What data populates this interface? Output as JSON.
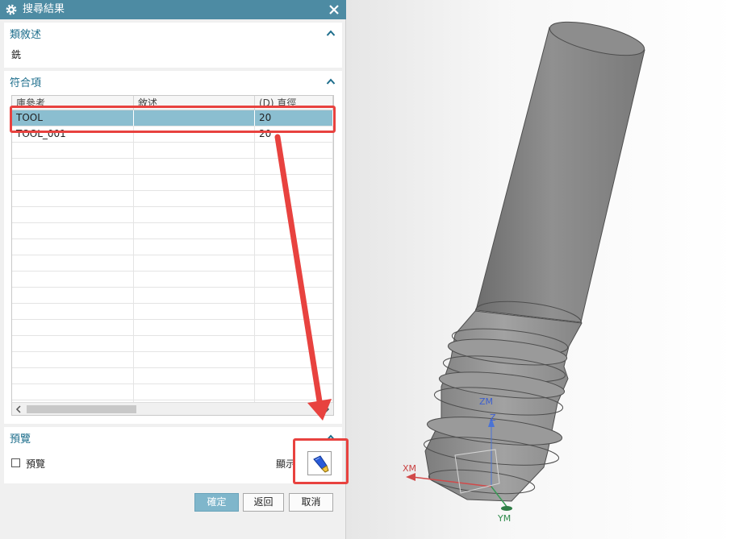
{
  "dialog": {
    "title": "搜尋結果",
    "icons": {
      "title": "gear-icon",
      "close": "close-icon"
    }
  },
  "description_section": {
    "title": "類敘述",
    "value": "銑"
  },
  "matches_section": {
    "title": "符合項",
    "columns": [
      "庫參考",
      "敘述",
      "(D) 直徑"
    ],
    "rows": [
      {
        "ref": "TOOL",
        "desc": "",
        "diameter": "20",
        "selected": true
      },
      {
        "ref": "TOOL_001",
        "desc": "",
        "diameter": "20",
        "selected": false
      }
    ],
    "empty_row_count": 17
  },
  "preview_section": {
    "title": "預覽",
    "checkbox_label": "預覽",
    "checkbox_checked": false,
    "show_label": "顯示"
  },
  "buttons": {
    "ok": "確定",
    "back": "返回",
    "cancel": "取消"
  },
  "viewport": {
    "axis_labels": {
      "zm": "ZM",
      "z": "Z",
      "xm": "XM",
      "ym": "YM"
    }
  },
  "colors": {
    "titlebar": "#4d8ba3",
    "section_title": "#1e6e8c",
    "selected_row": "#8bbed0",
    "annotation": "#e8423f",
    "tool_body": "#8a8a8a"
  }
}
